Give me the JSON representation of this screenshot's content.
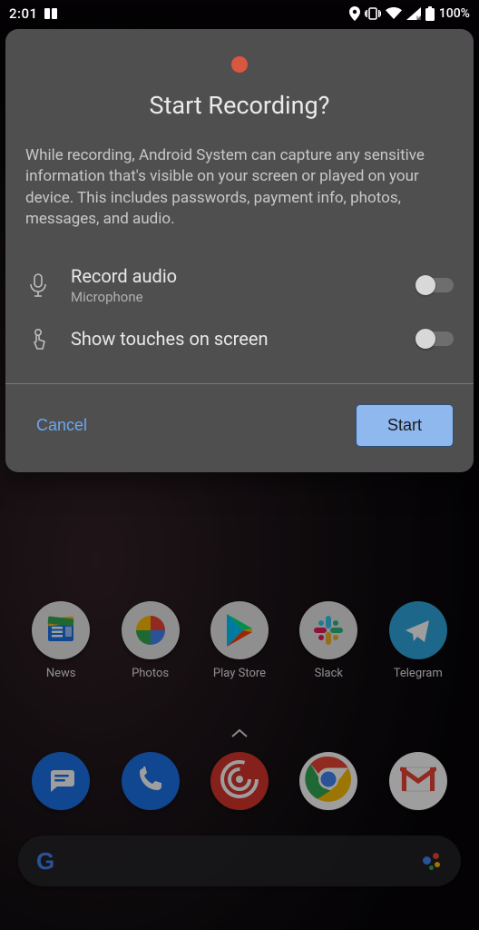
{
  "statusbar": {
    "clock": "2:01",
    "battery_text": "100%"
  },
  "dialog": {
    "title": "Start Recording?",
    "message": "While recording, Android System can capture any sensitive information that's visible on your screen or played on your device. This includes passwords, payment info, photos, messages, and audio.",
    "options": [
      {
        "title": "Record audio",
        "subtitle": "Microphone",
        "enabled": false,
        "icon": "mic-icon"
      },
      {
        "title": "Show touches on screen",
        "subtitle": "",
        "enabled": false,
        "icon": "touch-icon"
      }
    ],
    "cancel_label": "Cancel",
    "start_label": "Start"
  },
  "apps": {
    "row": [
      {
        "label": "News",
        "icon": "news-icon"
      },
      {
        "label": "Photos",
        "icon": "photos-icon"
      },
      {
        "label": "Play Store",
        "icon": "play-store-icon"
      },
      {
        "label": "Slack",
        "icon": "slack-icon"
      },
      {
        "label": "Telegram",
        "icon": "telegram-icon"
      }
    ],
    "dock": [
      {
        "label": "Messages",
        "icon": "messages-icon"
      },
      {
        "label": "Phone",
        "icon": "phone-icon"
      },
      {
        "label": "Pocket Casts",
        "icon": "pocketcasts-icon"
      },
      {
        "label": "Chrome",
        "icon": "chrome-icon"
      },
      {
        "label": "Gmail",
        "icon": "gmail-icon"
      }
    ]
  },
  "colors": {
    "dialog_bg": "#4f4f4f",
    "accent_blue": "#6aa8ef",
    "start_button_bg": "#8fb8ef",
    "record_dot": "#d9563f"
  }
}
